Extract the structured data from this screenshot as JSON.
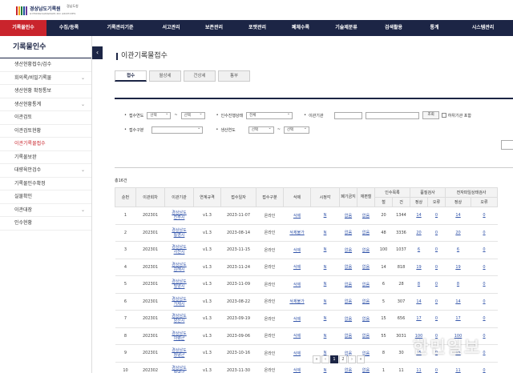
{
  "header": {
    "logo_text": "경상남도기록원",
    "logo_sub": "GYEONGSANGNAM-DO ARCHIVES",
    "top_link": "경남도청",
    "logo_colors": [
      "#c9242c",
      "#f2a51a",
      "#1f7a3a",
      "#1c4f9c",
      "#6b3a99"
    ]
  },
  "nav": {
    "items": [
      "기록물인수",
      "수집/등록",
      "기록관리기준",
      "서고관리",
      "보존관리",
      "포맷관리",
      "폐체수록",
      "기술제분류",
      "검색활용",
      "통계",
      "시스템관리"
    ],
    "active_index": 0,
    "active_color": "#c9242c",
    "bg_color": "#1c2545"
  },
  "sidebar": {
    "title": "기록물인수",
    "toggle_icon": "‹",
    "items": [
      {
        "label": "생산현황접수/검수",
        "chevron": ""
      },
      {
        "label": "회의록/비밀기록물",
        "chevron": "⌄"
      },
      {
        "label": "생산현황 확정통보",
        "chevron": ""
      },
      {
        "label": "생산현황통계",
        "chevron": "⌄"
      },
      {
        "label": "이관검토",
        "chevron": ""
      },
      {
        "label": "이관검토현황",
        "chevron": ""
      },
      {
        "label": "이관기록물접수",
        "chevron": "",
        "active": true
      },
      {
        "label": "기록물보완",
        "chevron": ""
      },
      {
        "label": "대량육안검수",
        "chevron": "⌄"
      },
      {
        "label": "기록물인수확정",
        "chevron": ""
      },
      {
        "label": "실물확인",
        "chevron": ""
      },
      {
        "label": "이관대장",
        "chevron": "⌄"
      },
      {
        "label": "인수현황",
        "chevron": ""
      }
    ]
  },
  "page": {
    "title": "이관기록물접수",
    "tabs": [
      "접수",
      "월상세",
      "건상세",
      "통부"
    ],
    "active_tab": 0
  },
  "filter": {
    "year_label": "접수연도",
    "year_from": "선택",
    "year_to": "선택",
    "status_label": "인수진행상태",
    "status_value": "전체",
    "org_label": "이관기관",
    "search_button": "조회",
    "subgroup_label": "하위기관 포함",
    "type_label": "접수구분",
    "prodyear_label": "생산연도",
    "prod_from": "선택",
    "prod_to": "선택",
    "range_sep": "~",
    "bullet": "•"
  },
  "total": "총16건",
  "table": {
    "headers_top": [
      "순번",
      "이관회차",
      "이관기관",
      "연계규격",
      "접수일자",
      "접수구분",
      "삭제",
      "시정각",
      "폐기금지",
      "재편철",
      "인수목록",
      "품질검사",
      "전자파일상태검사"
    ],
    "headers_sub": [
      "철",
      "건",
      "정상",
      "오류",
      "정상",
      "오류"
    ],
    "rows": [
      {
        "no": "1",
        "round": "202301",
        "org": [
          "경상남도",
          "진주시"
        ],
        "spec": "v1.3",
        "date": "2023-11-07",
        "type": "온라인",
        "del": "삭제",
        "fix": "N",
        "nodisp": "없음",
        "refile": "없음",
        "vol": "20",
        "cnt": "1344",
        "qok": "14",
        "qerr": "0",
        "fok": "14",
        "ferr": "0"
      },
      {
        "no": "2",
        "round": "202301",
        "org": [
          "경상남도",
          "통영시"
        ],
        "spec": "v1.3",
        "date": "2023-08-14",
        "type": "온라인",
        "del": "삭제불가",
        "fix": "N",
        "nodisp": "없음",
        "refile": "없음",
        "vol": "48",
        "cnt": "3336",
        "qok": "20",
        "qerr": "0",
        "fok": "20",
        "ferr": "0"
      },
      {
        "no": "3",
        "round": "202301",
        "org": [
          "경상남도",
          "사천시"
        ],
        "spec": "v1.3",
        "date": "2023-11-15",
        "type": "온라인",
        "del": "삭제",
        "fix": "N",
        "nodisp": "없음",
        "refile": "없음",
        "vol": "100",
        "cnt": "1037",
        "qok": "6",
        "qerr": "0",
        "fok": "6",
        "ferr": "0"
      },
      {
        "no": "4",
        "round": "202301",
        "org": [
          "경상남도",
          "김해시"
        ],
        "spec": "v1.3",
        "date": "2023-11-24",
        "type": "온라인",
        "del": "삭제",
        "fix": "N",
        "nodisp": "없음",
        "refile": "없음",
        "vol": "14",
        "cnt": "818",
        "qok": "19",
        "qerr": "0",
        "fok": "19",
        "ferr": "0"
      },
      {
        "no": "5",
        "round": "202301",
        "org": [
          "경상남도",
          "밀양시"
        ],
        "spec": "v1.3",
        "date": "2023-11-09",
        "type": "온라인",
        "del": "삭제",
        "fix": "N",
        "nodisp": "없음",
        "refile": "없음",
        "vol": "6",
        "cnt": "28",
        "qok": "8",
        "qerr": "0",
        "fok": "8",
        "ferr": "0"
      },
      {
        "no": "6",
        "round": "202301",
        "org": [
          "경상남도",
          "거제시"
        ],
        "spec": "v1.3",
        "date": "2023-08-22",
        "type": "온라인",
        "del": "삭제불가",
        "fix": "N",
        "nodisp": "없음",
        "refile": "없음",
        "vol": "5",
        "cnt": "307",
        "qok": "14",
        "qerr": "0",
        "fok": "14",
        "ferr": "0"
      },
      {
        "no": "7",
        "round": "202301",
        "org": [
          "경상남도",
          "양산시"
        ],
        "spec": "v1.3",
        "date": "2023-09-19",
        "type": "온라인",
        "del": "삭제",
        "fix": "N",
        "nodisp": "없음",
        "refile": "없음",
        "vol": "15",
        "cnt": "656",
        "qok": "17",
        "qerr": "0",
        "fok": "17",
        "ferr": "0"
      },
      {
        "no": "8",
        "round": "202301",
        "org": [
          "경상남도",
          "의령군"
        ],
        "spec": "v1.3",
        "date": "2023-09-06",
        "type": "온라인",
        "del": "삭제",
        "fix": "N",
        "nodisp": "없음",
        "refile": "없음",
        "vol": "55",
        "cnt": "3031",
        "qok": "100",
        "qerr": "0",
        "fok": "100",
        "ferr": "0"
      },
      {
        "no": "9",
        "round": "202301",
        "org": [
          "경상남도",
          "창녕군"
        ],
        "spec": "v1.3",
        "date": "2023-10-16",
        "type": "온라인",
        "del": "삭제",
        "fix": "N",
        "nodisp": "없음",
        "refile": "없음",
        "vol": "8",
        "cnt": "30",
        "qok": "15",
        "qerr": "0",
        "fok": "15",
        "ferr": "0"
      },
      {
        "no": "10",
        "round": "202302",
        "org": [
          "경상남도",
          "창녕군"
        ],
        "spec": "v1.3",
        "date": "2023-11-30",
        "type": "온라인",
        "del": "삭제",
        "fix": "N",
        "nodisp": "없음",
        "refile": "없음",
        "vol": "1",
        "cnt": "11",
        "qok": "11",
        "qerr": "0",
        "fok": "11",
        "ferr": "0"
      }
    ]
  },
  "pager": {
    "first": "«",
    "prev": "‹",
    "pages": [
      "1",
      "2"
    ],
    "active": "1",
    "next": "›",
    "last": "»"
  },
  "watermark": "한민일보"
}
